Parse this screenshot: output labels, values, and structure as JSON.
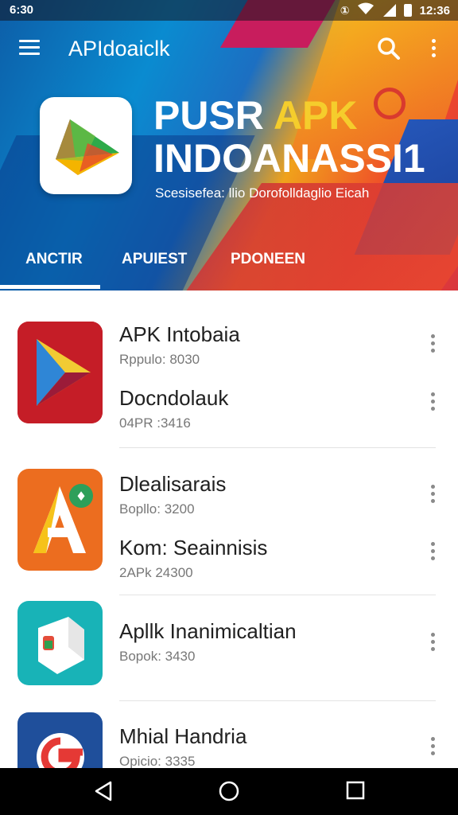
{
  "status_bar": {
    "time_left": "6:30",
    "time_right": "12:36"
  },
  "app_bar": {
    "title": "APIdoaiclk",
    "menu_icon": "menu-icon",
    "search_icon": "search-icon",
    "overflow_icon": "overflow-icon"
  },
  "banner": {
    "title_part1": "PUSR ",
    "title_highlight": "APK",
    "title_line2": "INDOANASSI1",
    "subtitle": "Scesisefea: llio Dorofolldaglio Eicah",
    "logo_icon": "play-triangle-logo-icon"
  },
  "tabs": [
    {
      "label": "ANCTIR",
      "selected": true
    },
    {
      "label": "APUIEST",
      "selected": false
    },
    {
      "label": "PDONEEN",
      "selected": false
    }
  ],
  "list": [
    {
      "icon": "red-play-icon",
      "entries": [
        {
          "name": "APK Intobaia",
          "meta": "Rppulo: 8030"
        },
        {
          "name": "Docndolauk",
          "meta": "04PR :3416"
        }
      ]
    },
    {
      "icon": "orange-letter-a-icon",
      "entries": [
        {
          "name": "Dlealisarais",
          "meta": "Bopllo: 3200"
        },
        {
          "name": "Kom: Seainnisis",
          "meta": "2APk 24300"
        }
      ]
    },
    {
      "icon": "teal-box-icon",
      "entries": [
        {
          "name": "Apllk Inanimicaltian",
          "meta": "Bopok: 3430"
        }
      ]
    },
    {
      "icon": "google-g-icon",
      "entries": [
        {
          "name": "Mhial Handria",
          "meta": "Opicio: 3335"
        }
      ]
    }
  ],
  "nav_bar": {
    "back_icon": "back-icon",
    "home_icon": "home-icon",
    "recents_icon": "recents-icon"
  },
  "colors": {
    "accent_yellow": "#f5cd2c",
    "text_primary": "#202020",
    "text_secondary": "#777777"
  }
}
